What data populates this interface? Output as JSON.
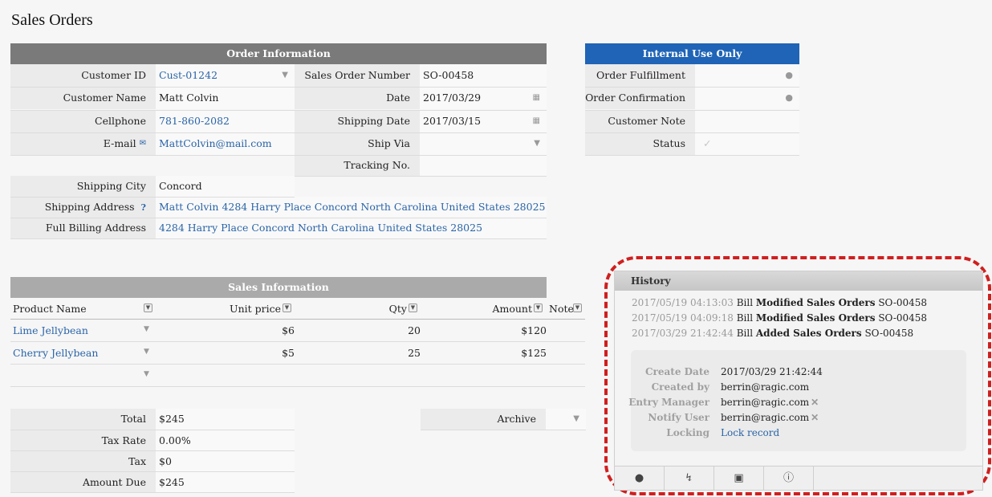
{
  "page_title": "Sales Orders",
  "order_info": {
    "header": "Order Information",
    "customer_id_label": "Customer ID",
    "customer_id": "Cust-01242",
    "customer_name_label": "Customer Name",
    "customer_name": "Matt Colvin",
    "cellphone_label": "Cellphone",
    "cellphone": "781-860-2082",
    "email_label": "E-mail",
    "email": "MattColvin@mail.com",
    "so_number_label": "Sales Order Number",
    "so_number": "SO-00458",
    "date_label": "Date",
    "date": "2017/03/29",
    "shipping_date_label": "Shipping Date",
    "shipping_date": "2017/03/15",
    "ship_via_label": "Ship Via",
    "ship_via": "",
    "tracking_label": "Tracking No.",
    "tracking": "",
    "shipping_city_label": "Shipping City",
    "shipping_city": "Concord",
    "shipping_address_label": "Shipping Address",
    "shipping_address": "Matt Colvin 4284 Harry Place Concord North Carolina United States 28025",
    "billing_address_label": "Full Billing Address",
    "billing_address": "4284 Harry Place Concord North Carolina United States 28025"
  },
  "internal": {
    "header": "Internal Use Only",
    "order_fulfillment_label": "Order Fulfillment",
    "order_confirmation_label": "Order Confirmation",
    "customer_note_label": "Customer Note",
    "status_label": "Status"
  },
  "sales_info": {
    "header": "Sales Information",
    "columns": {
      "product": "Product Name",
      "unit_price": "Unit price",
      "qty": "Qty",
      "amount": "Amount",
      "note": "Note"
    },
    "rows": [
      {
        "product": "Lime Jellybean",
        "unit_price": "$6",
        "qty": "20",
        "amount": "$120"
      },
      {
        "product": "Cherry Jellybean",
        "unit_price": "$5",
        "qty": "25",
        "amount": "$125"
      }
    ]
  },
  "totals": {
    "total_label": "Total",
    "total": "$245",
    "tax_rate_label": "Tax Rate",
    "tax_rate": "0.00%",
    "tax_label": "Tax",
    "tax": "$0",
    "amount_due_label": "Amount Due",
    "amount_due": "$245",
    "archive_label": "Archive",
    "archive": ""
  },
  "history": {
    "title": "History",
    "entries": [
      {
        "ts": "2017/05/19 04:13:03",
        "user": "Bill",
        "action": "Modified Sales Orders",
        "record": "SO-00458"
      },
      {
        "ts": "2017/05/19 04:09:18",
        "user": "Bill",
        "action": "Modified Sales Orders",
        "record": "SO-00458"
      },
      {
        "ts": "2017/03/29 21:42:44",
        "user": "Bill",
        "action": "Added Sales Orders",
        "record": "SO-00458"
      }
    ],
    "meta": {
      "create_date_label": "Create Date",
      "create_date": "2017/03/29 21:42:44",
      "created_by_label": "Created by",
      "created_by": "berrin@ragic.com",
      "entry_manager_label": "Entry Manager",
      "entry_manager": "berrin@ragic.com",
      "notify_user_label": "Notify User",
      "notify_user": "berrin@ragic.com",
      "locking_label": "Locking",
      "locking": "Lock record"
    }
  },
  "icons": {
    "dropdown": "chevron-down-icon",
    "calendar": "calendar-icon",
    "user": "user-icon",
    "mail": "mail-icon",
    "help": "help-icon",
    "check": "check-icon",
    "comment": "comment-icon",
    "bolt": "bolt-icon",
    "clipboard": "clipboard-icon",
    "info": "info-icon"
  },
  "colors": {
    "header_gray": "#7a7a7a",
    "header_blue": "#1f64b6",
    "link": "#2a64a8",
    "highlight": "#d01f1f"
  }
}
